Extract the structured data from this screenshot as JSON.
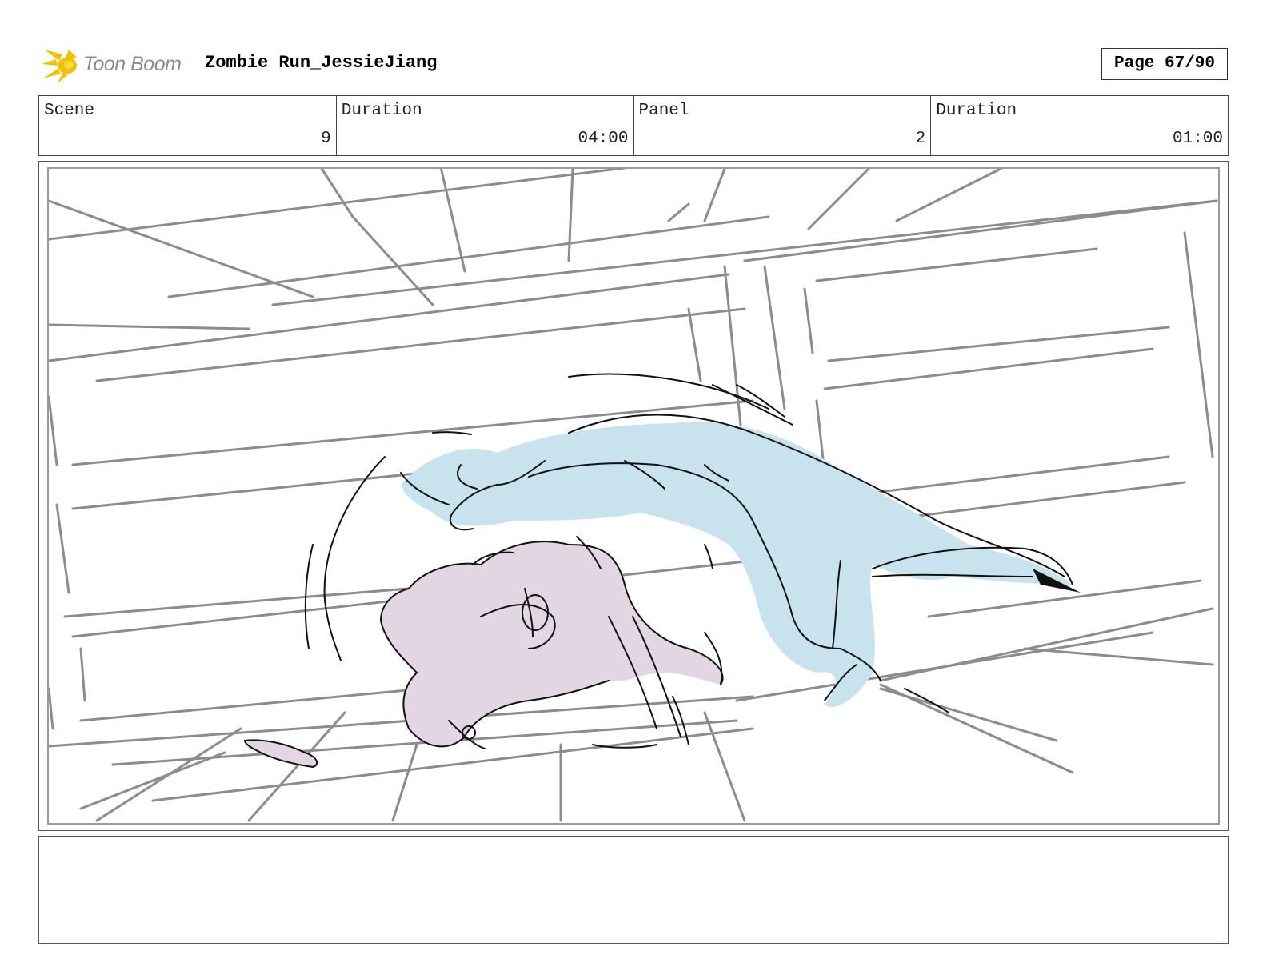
{
  "header": {
    "logo_text": "Toon Boom",
    "project_title": "Zombie Run_JessieJiang",
    "page_label": "Page 67/90"
  },
  "info": {
    "scene_label": "Scene",
    "scene_value": "9",
    "scene_duration_label": "Duration",
    "scene_duration_value": "04:00",
    "panel_label": "Panel",
    "panel_value": "2",
    "panel_duration_label": "Duration",
    "panel_duration_value": "01:00"
  },
  "colors": {
    "logo_star": "#f2c200",
    "zombie_fill": "#c8e3ed",
    "character_fill": "#e3d6e3",
    "background_lines": "#8c8c8c"
  },
  "icons": {
    "logo": "toon-boom-star-icon"
  },
  "notes": {
    "text": ""
  }
}
